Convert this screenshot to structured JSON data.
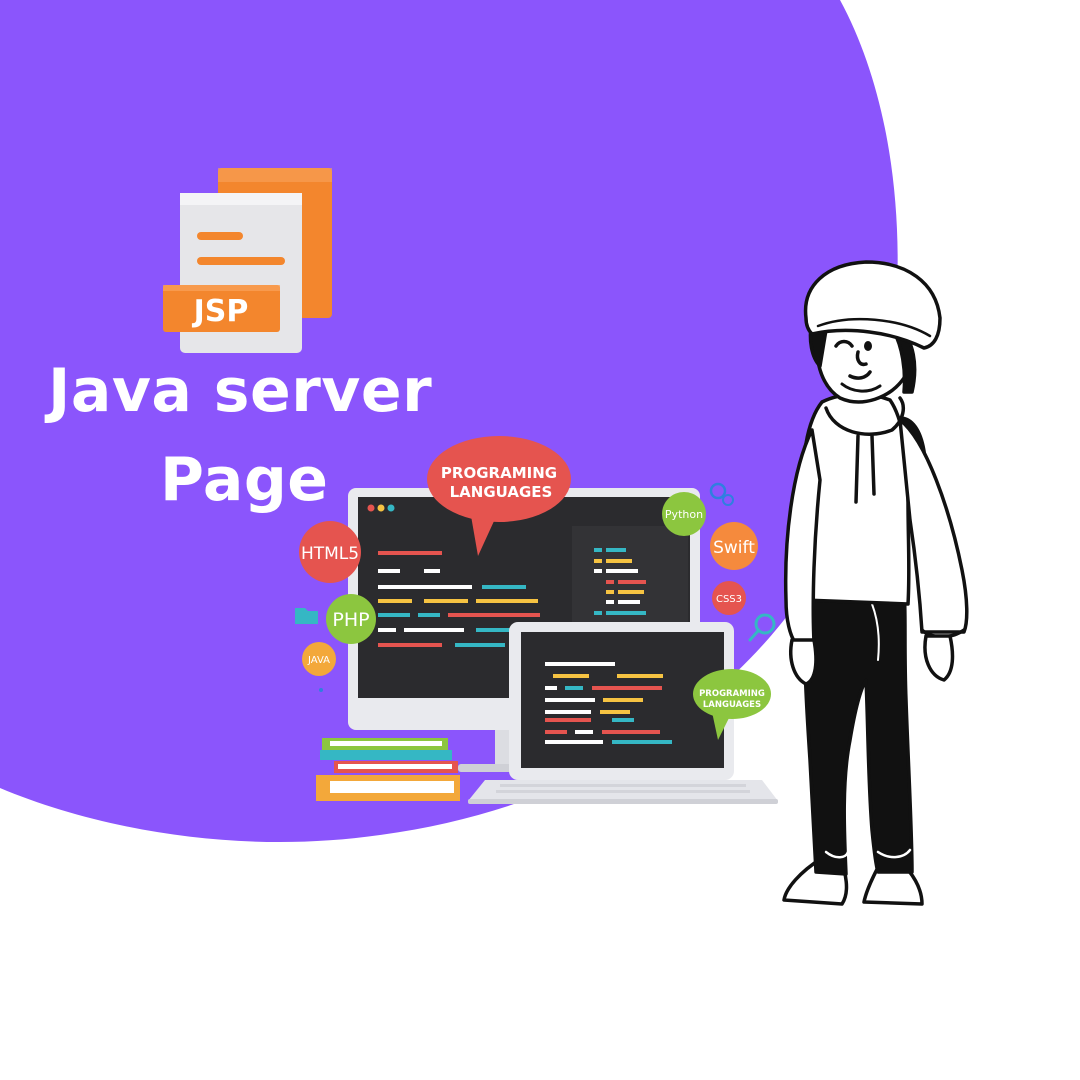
{
  "hero": {
    "title_line_1": "Java server",
    "title_line_2": "Page"
  },
  "file_icon": {
    "badge_text": "JSP"
  },
  "devices": {
    "main_bubble_line_1": "PROGRAMING",
    "main_bubble_line_2": "LANGUAGES",
    "small_bubble_line_1": "PROGRAMING",
    "small_bubble_line_2": "LANGUAGES"
  },
  "language_badges": {
    "html5": "HTML5",
    "php": "PHP",
    "java": "JAVA",
    "python": "Python",
    "swift": "Swift",
    "css3": "CSS3"
  },
  "colors": {
    "background_blob": "#8b55fc",
    "page_background": "#ffffff",
    "jsp_orange": "#f3862d",
    "bubble_red": "#e5544f",
    "bubble_green": "#8cc63f",
    "swift_orange": "#f58a3d"
  }
}
